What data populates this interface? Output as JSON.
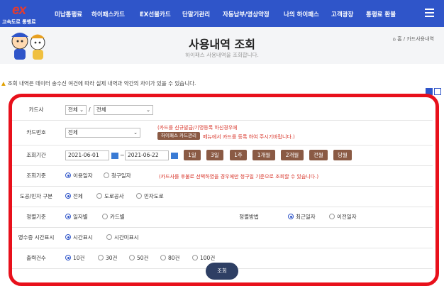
{
  "brand": {
    "logo_mark": "ex",
    "logo_text": "고속도로 통행료"
  },
  "nav": {
    "items": [
      "미납통행료",
      "하이패스카드",
      "EX선불카드",
      "단말기관리",
      "자동납부/영상약정",
      "나의 하이패스",
      "고객광장",
      "통행료 환불"
    ]
  },
  "header": {
    "title": "사용내역 조회",
    "subtitle": "하이패스 사용내역을 조회합니다.",
    "breadcrumb": "⌂ 홈  /  카드사용내역"
  },
  "notice": "조회 내역은 데이터 송수신 여건에 따라 실제 내역과 약간의 차이가 있을 수 있습니다.",
  "form": {
    "card_company": {
      "label": "카드사",
      "select1": "전체",
      "separator": "/",
      "select2": "전체"
    },
    "card_number": {
      "label": "카드번호",
      "value": "전체",
      "note1": "(카드를 신규발급/기명등록 하신경우에",
      "note_btn": "하이패스 카드관리",
      "note2": "메뉴에서 카드를 등록 하여 주시기바랍니다.)"
    },
    "period": {
      "label": "조회기간",
      "start": "2021-06-01",
      "tilde": "~",
      "end": "2021-06-22",
      "buttons": [
        "1일",
        "3일",
        "1주",
        "1개월",
        "2개월",
        "전월",
        "당월"
      ]
    },
    "criteria": {
      "label": "조회기준",
      "options": [
        "이용일자",
        "청구일자"
      ],
      "selected": "이용일자",
      "note": "(카드사를 후불로 선택하였을 경우에만 청구일 기준으로 조회할 수 있습니다.)"
    },
    "road": {
      "label": "도공/민자 구분",
      "options": [
        "전체",
        "도로공사",
        "민자도로"
      ],
      "selected": "전체"
    },
    "sort_basis": {
      "label": "정렬기준",
      "options": [
        "일자별",
        "카드별"
      ],
      "selected": "일자별"
    },
    "sort_method": {
      "label": "정렬방법",
      "options": [
        "최근일자",
        "이전일자"
      ],
      "selected": "최근일자"
    },
    "receipt_time": {
      "label": "영수증 시간표시",
      "options": [
        "시간표시",
        "시간미표시"
      ],
      "selected": "시간표시"
    },
    "output_count": {
      "label": "출력건수",
      "options": [
        "10건",
        "30건",
        "50건",
        "80건",
        "100건"
      ],
      "selected": "10건"
    },
    "search_label": "조회"
  },
  "colors": {
    "nav_bg": "#2f55c9",
    "highlight": "#e8101b",
    "brown_btn": "#8a5a44",
    "search_btn": "#2e3f64"
  }
}
